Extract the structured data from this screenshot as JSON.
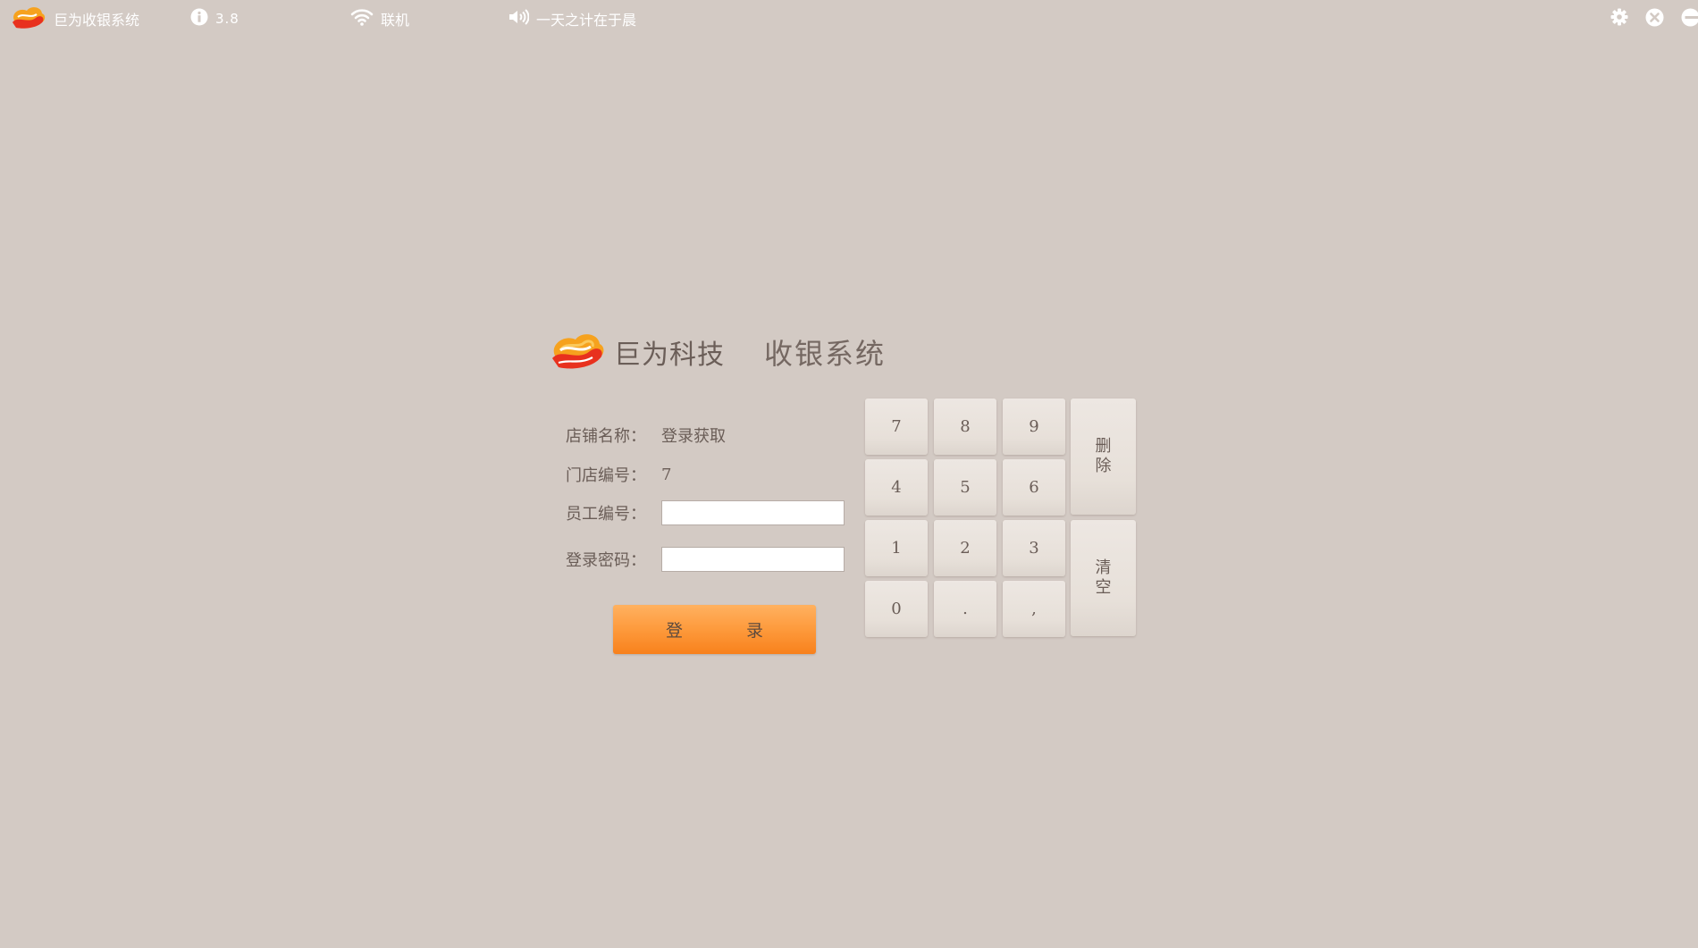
{
  "topbar": {
    "app_name": "巨为收银系统",
    "version": "3.8",
    "network_status": "联机",
    "marquee": "一天之计在于晨"
  },
  "brand": {
    "company": "巨为科技",
    "product": "收银系统"
  },
  "form": {
    "store_name_label": "店铺名称：",
    "store_name_value": "登录获取",
    "store_no_label": "门店编号：",
    "store_no_value": "7",
    "employee_label": "员工编号：",
    "employee_value": "",
    "password_label": "登录密码：",
    "password_value": "",
    "login_button": "登　录"
  },
  "keypad": {
    "keys": [
      "7",
      "8",
      "9",
      "4",
      "5",
      "6",
      "1",
      "2",
      "3",
      "0",
      ".",
      ","
    ],
    "delete_line1": "删",
    "delete_line2": "除",
    "clear_line1": "清",
    "clear_line2": "空"
  },
  "colors": {
    "background": "#d3cac4",
    "accent": "#fd9a3c",
    "text": "#6a5d57"
  },
  "icons": {
    "logo": "cloud-logo-icon",
    "version": "info-icon",
    "network": "wifi-icon",
    "sound": "speaker-icon",
    "settings": "gear-icon",
    "close": "close-icon",
    "minimize": "minimize-icon"
  }
}
